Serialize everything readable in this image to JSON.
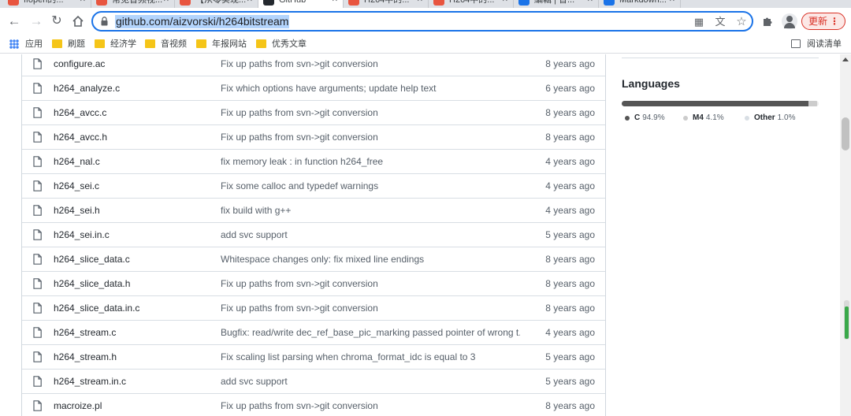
{
  "browser": {
    "tabs": [
      {
        "title": "ffopen的...",
        "favicon_color": "#e8553f"
      },
      {
        "title": "常见音频视...",
        "favicon_color": "#e8553f"
      },
      {
        "title": "【从零实现...",
        "favicon_color": "#e8553f"
      },
      {
        "title": "GitHub",
        "favicon_color": "#24292f",
        "active": true
      },
      {
        "title": "H264中的...",
        "favicon_color": "#e8553f"
      },
      {
        "title": "H264中的...",
        "favicon_color": "#e8553f"
      },
      {
        "title": "編輯 | 音...",
        "favicon_color": "#1a73e8"
      },
      {
        "title": "Markdown...",
        "favicon_color": "#1a73e8"
      }
    ],
    "url": "github.com/aizvorski/h264bitstream",
    "update_label": "更新",
    "bookmarks": {
      "apps_label": "应用",
      "folders": [
        "刷题",
        "经济学",
        "音视频",
        "年报网站",
        "优秀文章"
      ],
      "reading_list_label": "阅读清单"
    }
  },
  "files": [
    {
      "name": "configure.ac",
      "message": "Fix up paths from svn->git conversion",
      "age": "8 years ago"
    },
    {
      "name": "h264_analyze.c",
      "message": "Fix which options have arguments; update help text",
      "age": "6 years ago"
    },
    {
      "name": "h264_avcc.c",
      "message": "Fix up paths from svn->git conversion",
      "age": "8 years ago"
    },
    {
      "name": "h264_avcc.h",
      "message": "Fix up paths from svn->git conversion",
      "age": "8 years ago"
    },
    {
      "name": "h264_nal.c",
      "message": "fix memory leak : in function h264_free",
      "age": "4 years ago"
    },
    {
      "name": "h264_sei.c",
      "message": "Fix some calloc and typedef warnings",
      "age": "4 years ago"
    },
    {
      "name": "h264_sei.h",
      "message": "fix build with g++",
      "age": "4 years ago"
    },
    {
      "name": "h264_sei.in.c",
      "message": "add svc support",
      "age": "5 years ago"
    },
    {
      "name": "h264_slice_data.c",
      "message": "Whitespace changes only: fix mixed line endings",
      "age": "8 years ago"
    },
    {
      "name": "h264_slice_data.h",
      "message": "Fix up paths from svn->git conversion",
      "age": "8 years ago"
    },
    {
      "name": "h264_slice_data.in.c",
      "message": "Fix up paths from svn->git conversion",
      "age": "8 years ago"
    },
    {
      "name": "h264_stream.c",
      "message": "Bugfix: read/write dec_ref_base_pic_marking passed pointer of wrong t...",
      "age": "4 years ago"
    },
    {
      "name": "h264_stream.h",
      "message": "Fix scaling list parsing when chroma_format_idc is equal to 3",
      "age": "5 years ago"
    },
    {
      "name": "h264_stream.in.c",
      "message": "add svc support",
      "age": "5 years ago"
    },
    {
      "name": "macroize.pl",
      "message": "Fix up paths from svn->git conversion",
      "age": "8 years ago"
    }
  ],
  "languages": {
    "title": "Languages",
    "items": [
      {
        "name": "C",
        "percent": "94.9%",
        "value": 94.9,
        "color": "#555555"
      },
      {
        "name": "M4",
        "percent": "4.1%",
        "value": 4.1,
        "color": "#cccccc"
      },
      {
        "name": "Other",
        "percent": "1.0%",
        "value": 1.0,
        "color": "#ededed"
      }
    ]
  },
  "scroll_gauge_fraction": 0.85
}
